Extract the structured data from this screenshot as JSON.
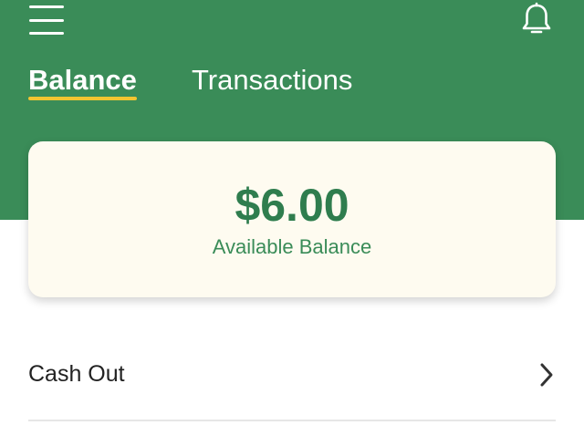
{
  "header": {
    "color": "#3a8c58",
    "menu_icon": "hamburger-menu-icon",
    "notification_icon": "bell-icon"
  },
  "tabs": [
    {
      "label": "Balance",
      "active": true
    },
    {
      "label": "Transactions",
      "active": false
    }
  ],
  "tab_indicator_color": "#f2c531",
  "balance_card": {
    "amount": "$6.00",
    "label": "Available Balance"
  },
  "actions": [
    {
      "label": "Cash Out",
      "icon": "chevron-right-icon"
    }
  ]
}
